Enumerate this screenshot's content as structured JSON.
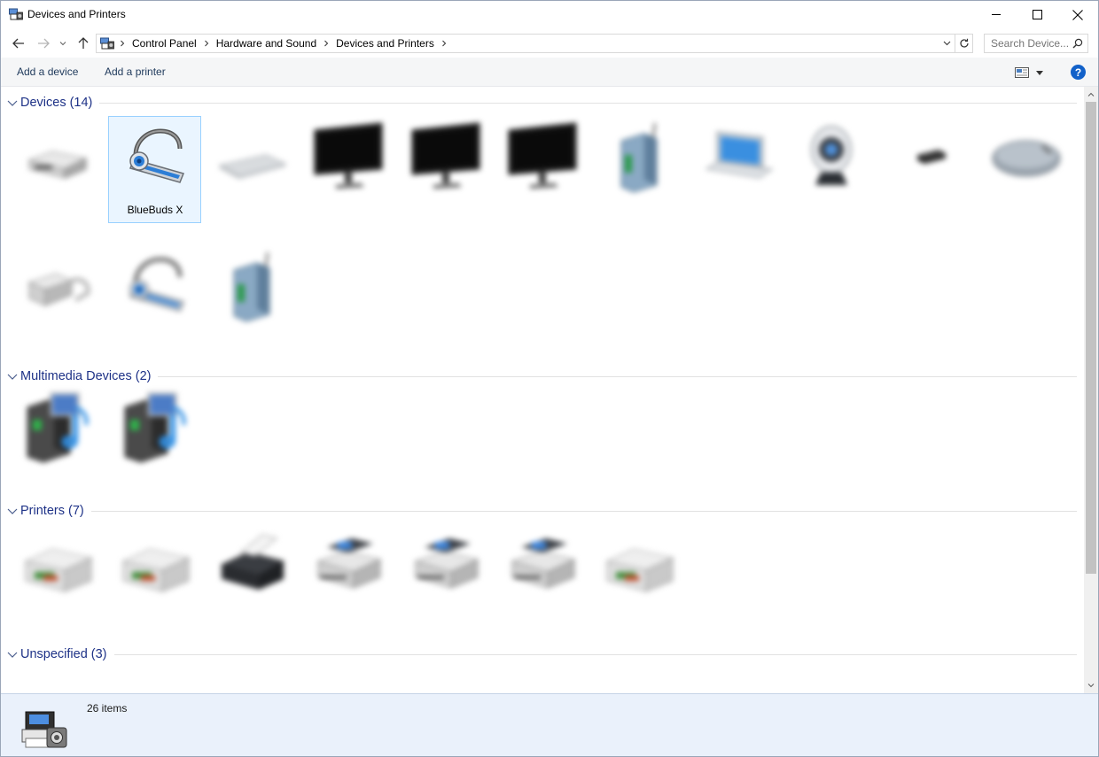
{
  "window": {
    "title": "Devices and Printers"
  },
  "nav": {
    "breadcrumbs": [
      "Control Panel",
      "Hardware and Sound",
      "Devices and Printers"
    ],
    "search_placeholder": "Search Device..."
  },
  "commands": {
    "add_device": "Add a device",
    "add_printer": "Add a printer",
    "help": "?"
  },
  "groups": [
    {
      "title": "Devices (14)",
      "items": [
        {
          "label": "",
          "icon": "drive-icon",
          "blurred": true
        },
        {
          "label": "BlueBuds X",
          "icon": "headset-icon",
          "blurred": false,
          "selected": true
        },
        {
          "label": "",
          "icon": "keyboard-icon",
          "blurred": true
        },
        {
          "label": "",
          "icon": "monitor-icon",
          "blurred": true
        },
        {
          "label": "",
          "icon": "monitor-icon",
          "blurred": true
        },
        {
          "label": "",
          "icon": "monitor-icon",
          "blurred": true
        },
        {
          "label": "",
          "icon": "router-icon",
          "blurred": true
        },
        {
          "label": "",
          "icon": "laptop-icon",
          "blurred": true
        },
        {
          "label": "",
          "icon": "webcam-icon",
          "blurred": true
        },
        {
          "label": "",
          "icon": "usb-receiver-icon",
          "blurred": true
        },
        {
          "label": "",
          "icon": "mouse-icon",
          "blurred": true
        },
        {
          "label": "",
          "icon": "usb-adapter-icon",
          "blurred": true
        },
        {
          "label": "",
          "icon": "headset-icon",
          "blurred": true
        },
        {
          "label": "",
          "icon": "router-icon",
          "blurred": true
        }
      ]
    },
    {
      "title": "Multimedia Devices (2)",
      "items": [
        {
          "label": "",
          "icon": "media-device-icon",
          "blurred": true
        },
        {
          "label": "",
          "icon": "media-device-icon",
          "blurred": true
        }
      ]
    },
    {
      "title": "Printers (7)",
      "items": [
        {
          "label": "",
          "icon": "printer-icon",
          "blurred": true
        },
        {
          "label": "",
          "icon": "printer-icon",
          "blurred": true
        },
        {
          "label": "",
          "icon": "fax-icon",
          "blurred": true
        },
        {
          "label": "",
          "icon": "virtual-printer-icon",
          "blurred": true
        },
        {
          "label": "",
          "icon": "virtual-printer-icon",
          "blurred": true
        },
        {
          "label": "",
          "icon": "virtual-printer-icon",
          "blurred": true
        },
        {
          "label": "",
          "icon": "printer-icon",
          "blurred": true
        }
      ]
    },
    {
      "title": "Unspecified (3)",
      "items": []
    }
  ],
  "details": {
    "count": "26 items"
  },
  "colors": {
    "group_title": "#1e3287",
    "selection_border": "#99d1ff",
    "selection_fill": "#eaf5ff",
    "details_bg": "#eaf1fb"
  }
}
